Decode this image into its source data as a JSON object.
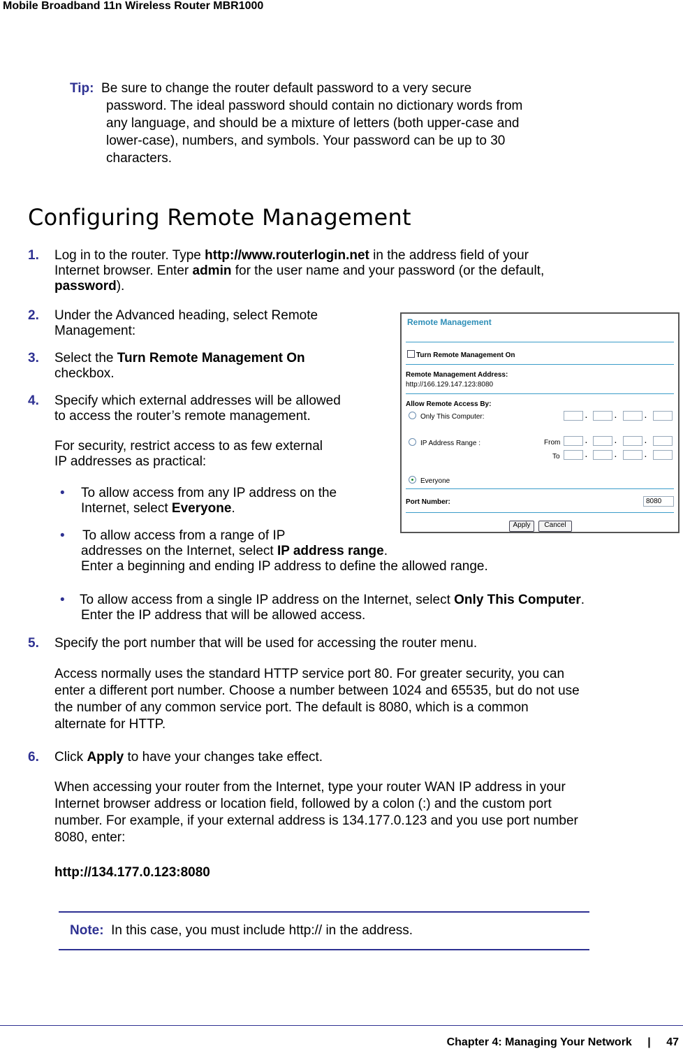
{
  "header": {
    "title": "Mobile Broadband 11n Wireless Router MBR1000"
  },
  "tip": {
    "label": "Tip:",
    "first_line": "Be sure to change the router default password to a very secure",
    "lines": [
      "password. The ideal password should contain no dictionary words from",
      "any language, and should be a mixture of letters (both upper-case and",
      "lower-case), numbers, and symbols. Your password can be up to 30",
      "characters."
    ]
  },
  "section_title": "Configuring Remote Management",
  "steps": {
    "s1": {
      "num": "1.",
      "a": "Log in to the router. Type ",
      "b1": "http://www.routerlogin.net",
      "c": " in the address field of your",
      "d": "Internet browser. Enter ",
      "b2": "admin",
      "e": " for the user name and your password (or the default,",
      "b3": "password",
      "f": ")."
    },
    "s2": {
      "num": "2.",
      "l1": "Under the Advanced heading, select Remote",
      "l2": "Management:"
    },
    "s3": {
      "num": "3.",
      "a": "Select the ",
      "b": "Turn Remote Management On",
      "l2": "checkbox."
    },
    "s4": {
      "num": "4.",
      "l1": "Specify which external addresses will be allowed",
      "l2": "to access the router’s remote management."
    },
    "s4_para": {
      "l1": "For security, restrict access to as few external",
      "l2": "IP addresses as practical:"
    },
    "bullets": {
      "dot": "•",
      "b1": {
        "l1": "To allow access from any IP address on the",
        "a": "Internet, select ",
        "b": "Everyone",
        "c": "."
      },
      "b2": {
        "l1": "To allow access from a range of IP",
        "a": "addresses on the Internet, select ",
        "b": "IP address range",
        "c": ".",
        "l3": "Enter a beginning and ending IP address to define the allowed range."
      },
      "b3": {
        "a": "To allow access from a single IP address on the Internet, select ",
        "b": "Only This Computer",
        "c": ".",
        "l2": "Enter the IP address that will be allowed access."
      }
    },
    "s5": {
      "num": "5.",
      "l1": "Specify the port number that will be used for accessing the router menu."
    },
    "s5_para": {
      "l1": "Access normally uses the standard HTTP service port 80. For greater security, you can",
      "l2": "enter a different port number. Choose a number between 1024 and 65535, but do not use",
      "l3": "the number of any common service port. The default is 8080, which is a common",
      "l4": "alternate for HTTP."
    },
    "s6": {
      "num": "6.",
      "a": "Click ",
      "b": "Apply",
      "c": " to have your changes take effect."
    },
    "s6_para": {
      "l1": "When accessing your router from the Internet, type your router WAN IP address in your",
      "l2": "Internet browser address or location field, followed by a colon (:) and the custom port",
      "l3": "number. For example, if your external address is 134.177.0.123 and you use port number",
      "l4": "8080, enter:"
    },
    "example_url": "http://134.177.0.123:8080"
  },
  "screenshot": {
    "title": "Remote Management",
    "checkbox_label": "Turn Remote Management On",
    "checkbox_checked": false,
    "address_label": "Remote Management Address:",
    "address_value": "http://166.129.147.123:8080",
    "access_label": "Allow Remote Access By:",
    "opt_only": "Only This Computer:",
    "opt_range": "IP Address Range :",
    "from_label": "From",
    "to_label": "To",
    "opt_everyone": "Everyone",
    "selected_option": "Everyone",
    "port_label": "Port Number:",
    "port_value": "8080",
    "apply": "Apply",
    "cancel": "Cancel",
    "dot": "."
  },
  "note": {
    "label": "Note:",
    "text": "In this case, you must include http:// in the address."
  },
  "footer": {
    "chapter": "Chapter 4:  Managing Your Network",
    "sep": "|",
    "page": "47"
  },
  "colors": {
    "accent": "#2e3192",
    "screen_title": "#2f8fb8"
  }
}
